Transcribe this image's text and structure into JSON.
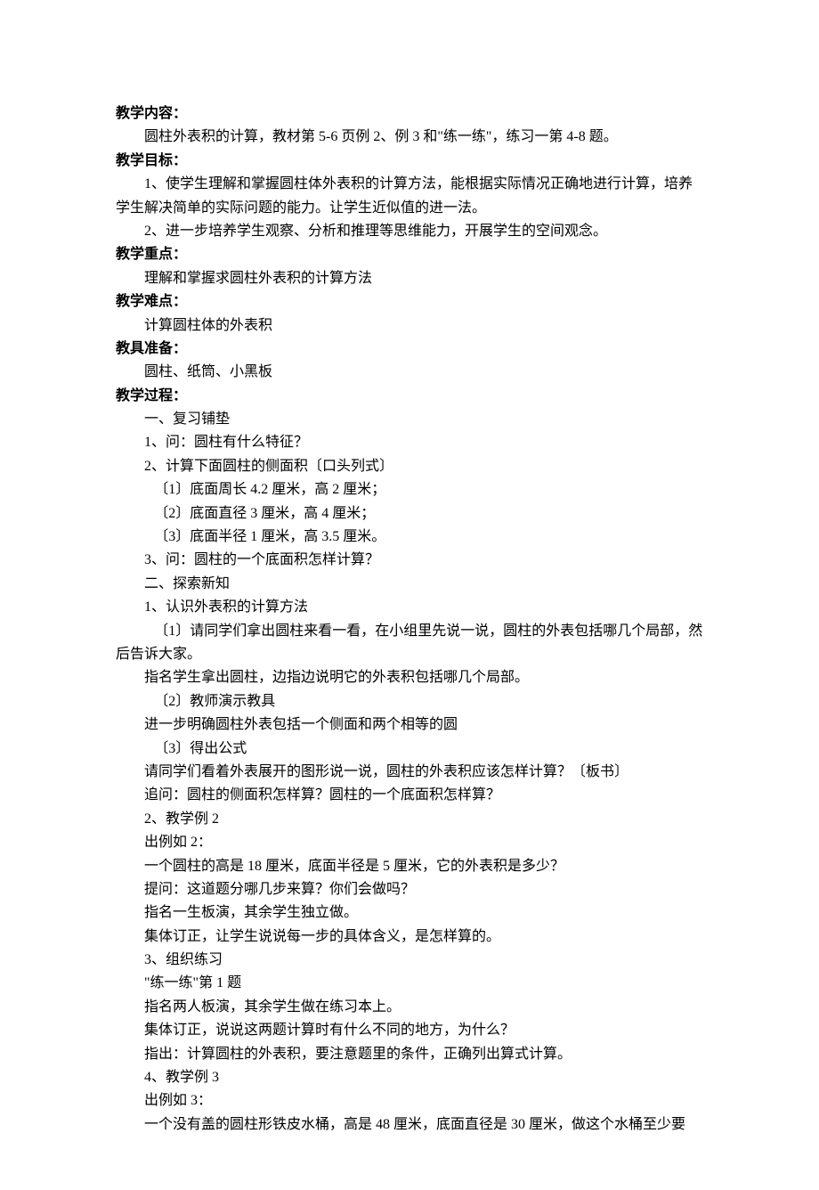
{
  "h1": {
    "label": "教学内容",
    "colon": "："
  },
  "c1": "圆柱外表积的计算，教材第 5-6 页例 2、例 3 和\"练一练\"，练习一第 4-8 题。",
  "h2": {
    "label": "教学目标",
    "colon": "："
  },
  "c2a": "1、使学生理解和掌握圆柱体外表积的计算方法，能根据实际情况正确地进行计算，培养学生解决简单的实际问题的能力。让学生近似值的进一法。",
  "c2b": "2、进一步培养学生观察、分析和推理等思维能力，开展学生的空间观念。",
  "h3": {
    "label": "教学重点",
    "colon": "："
  },
  "c3": "理解和掌握求圆柱外表积的计算方法",
  "h4": {
    "label": "教学难点",
    "colon": "："
  },
  "c4": "计算圆柱体的外表积",
  "h5": {
    "label": "教具准备",
    "colon": "："
  },
  "c5": "圆柱、纸筒、小黑板",
  "h6": {
    "label": "教学过程",
    "colon": "："
  },
  "l1": "一、复习铺垫",
  "l2": "1、问：圆柱有什么特征？",
  "l3": "2、计算下面圆柱的侧面积〔口头列式〕",
  "l4": "〔1〕底面周长 4.2 厘米，高 2 厘米；",
  "l5": "〔2〕底面直径 3 厘米，高 4 厘米；",
  "l6": "〔3〕底面半径 1 厘米，高 3.5 厘米。",
  "l7": "3、问：圆柱的一个底面积怎样计算？",
  "l8": "二、探索新知",
  "l9": "1、认识外表积的计算方法",
  "l10": "〔1〕请同学们拿出圆柱来看一看，在小组里先说一说，圆柱的外表包括哪几个局部，然后告诉大家。",
  "l11": "指名学生拿出圆柱，边指边说明它的外表积包括哪几个局部。",
  "l12": "〔2〕教师演示教具",
  "l13": "进一步明确圆柱外表包括一个侧面和两个相等的圆",
  "l14": "〔3〕得出公式",
  "l15": "请同学们看着外表展开的图形说一说，圆柱的外表积应该怎样计算？〔板书〕",
  "l16": "追问：圆柱的侧面积怎样算？圆柱的一个底面积怎样算？",
  "l17": "2、教学例 2",
  "l18": "出例如 2：",
  "l19": "一个圆柱的高是 18 厘米，底面半径是 5 厘米，它的外表积是多少？",
  "l20": "提问：这道题分哪几步来算？你们会做吗？",
  "l21": "指名一生板演，其余学生独立做。",
  "l22": "集体订正，让学生说说每一步的具体含义，是怎样算的。",
  "l23": "3、组织练习",
  "l24": "\"练一练\"第 1 题",
  "l25": "指名两人板演，其余学生做在练习本上。",
  "l26": "集体订正，说说这两题计算时有什么不同的地方，为什么？",
  "l27": "指出：计算圆柱的外表积，要注意题里的条件，正确列出算式计算。",
  "l28": "4、教学例 3",
  "l29": "出例如 3：",
  "l30": "一个没有盖的圆柱形铁皮水桶，高是 48 厘米，底面直径是 30 厘米，做这个水桶至少要"
}
